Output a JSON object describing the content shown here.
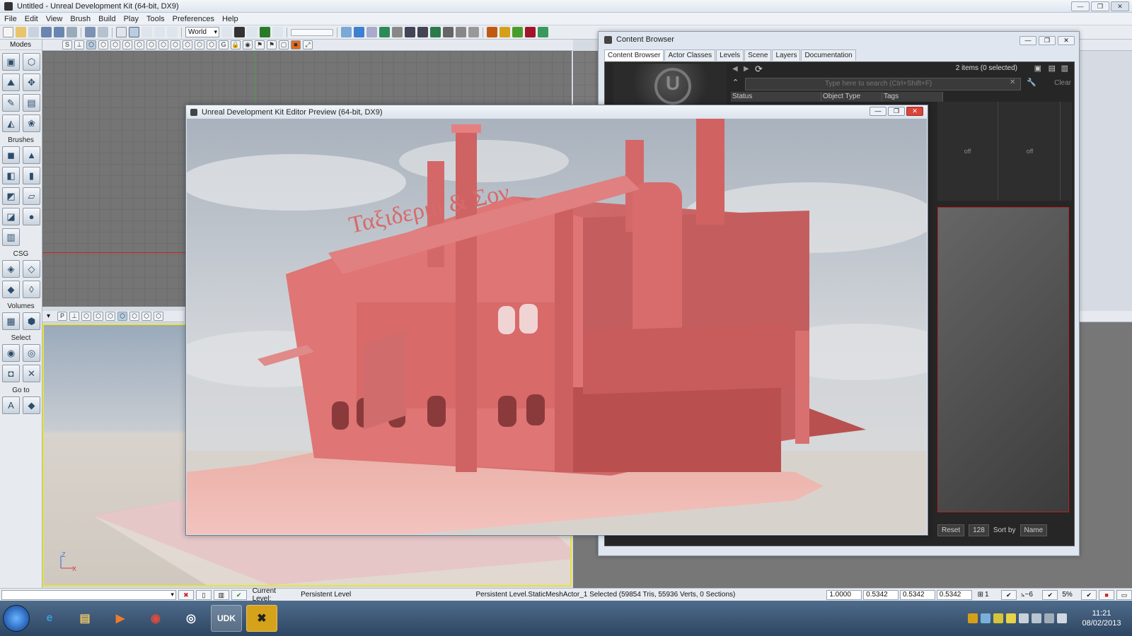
{
  "window": {
    "title": "Untitled - Unreal Development Kit (64-bit, DX9)"
  },
  "menu": [
    "File",
    "Edit",
    "View",
    "Brush",
    "Build",
    "Play",
    "Tools",
    "Preferences",
    "Help"
  ],
  "toolbar": {
    "coord_system": "World"
  },
  "modes_panel": {
    "header": "Modes",
    "groups": {
      "brushes": "Brushes",
      "csg": "CSG",
      "volumes": "Volumes",
      "select": "Select",
      "goto": "Go to"
    }
  },
  "content_browser": {
    "title": "Content Browser",
    "tabs": [
      "Content Browser",
      "Actor Classes",
      "Levels",
      "Scene",
      "Layers",
      "Documentation"
    ],
    "item_count": "2 items (0 selected)",
    "search_placeholder": "Type here to search (Ctrl+Shift+F)",
    "clear_label": "Clear",
    "columns": [
      "Status",
      "Object Type",
      "Tags"
    ],
    "tiles": [
      "off",
      "off"
    ],
    "reset_label": "Reset",
    "thumb_size": "128",
    "sort_label": "Sort by",
    "sort_value": "Name"
  },
  "preview_window": {
    "title": "Unreal Development Kit Editor Preview (64-bit, DX9)",
    "sign_text": "Ταξιδερμι   & Σον"
  },
  "status_bar": {
    "current_level_label": "Current Level:",
    "current_level_value": "Persistent Level",
    "selection_info": "Persistent Level.StaticMeshActor_1 Selected (59854 Tris, 55936 Verts, 0 Sections)",
    "drag_scale": "1.0000",
    "scale_x": "0.5342",
    "scale_y": "0.5342",
    "scale_z": "0.5342",
    "grid_value": "1",
    "rot_snap": "~6",
    "pct": "5%"
  },
  "taskbar": {
    "time": "11:21",
    "date": "08/02/2013",
    "apps": [
      "IE",
      "Explorer",
      "Media",
      "Chrome",
      "Steam",
      "UDK",
      "Game"
    ]
  }
}
